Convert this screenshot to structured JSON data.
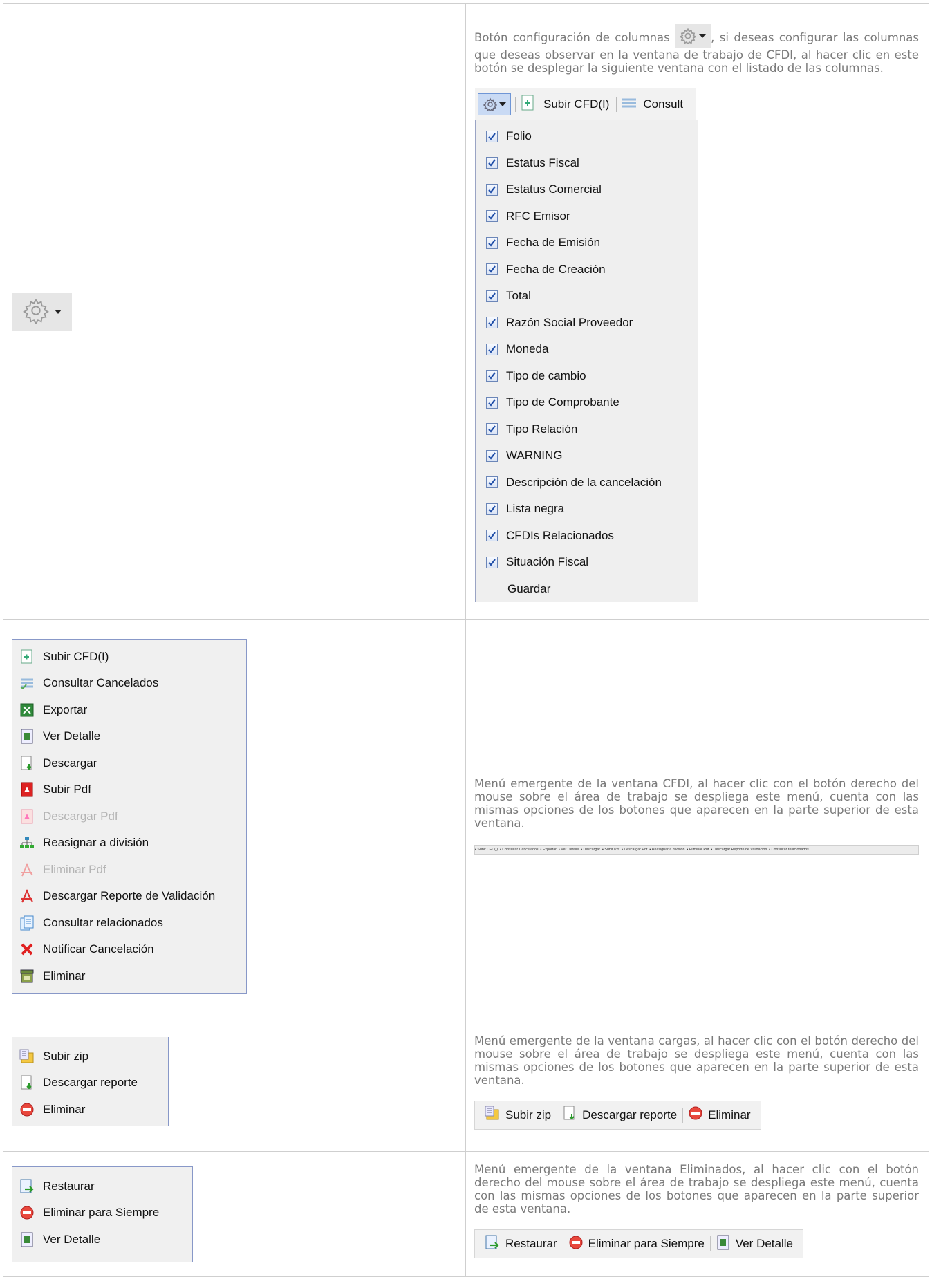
{
  "row1": {
    "description_pre": "Botón configuración de columnas",
    "description_post": ", si deseas configurar las columnas que deseas observar en la ventana de trabajo de CFDI, al hacer clic en este botón se desplegar la siguiente ventana con el listado de las columnas.",
    "toolbar": {
      "upload_label": "Subir CFD(I)",
      "consult_label": "Consult"
    },
    "columns": [
      "Folio",
      "Estatus Fiscal",
      "Estatus Comercial",
      "RFC Emisor",
      "Fecha de Emisión",
      "Fecha de Creación",
      "Total",
      "Razón Social Proveedor",
      "Moneda",
      "Tipo de cambio",
      "Tipo de Comprobante",
      "Tipo Relación",
      "WARNING",
      "Descripción de la cancelación",
      "Lista negra",
      "CFDIs Relacionados",
      "Situación Fiscal"
    ],
    "save_label": "Guardar"
  },
  "row2": {
    "menu": [
      {
        "label": "Subir CFD(I)",
        "icon": "upload-doc-icon",
        "disabled": false
      },
      {
        "label": "Consultar Cancelados",
        "icon": "list-check-icon",
        "disabled": false
      },
      {
        "label": "Exportar",
        "icon": "excel-icon",
        "disabled": false
      },
      {
        "label": "Ver Detalle",
        "icon": "detail-icon",
        "disabled": false
      },
      {
        "label": "Descargar",
        "icon": "download-icon",
        "disabled": false
      },
      {
        "label": "Subir Pdf",
        "icon": "pdf-upload-icon",
        "disabled": false
      },
      {
        "label": "Descargar Pdf",
        "icon": "pdf-download-icon",
        "disabled": true
      },
      {
        "label": "Reasignar a división",
        "icon": "hierarchy-icon",
        "disabled": false
      },
      {
        "label": "Eliminar Pdf",
        "icon": "pdf-delete-icon",
        "disabled": true
      },
      {
        "label": "Descargar Reporte de Validación",
        "icon": "acrobat-icon",
        "disabled": false
      },
      {
        "label": "Consultar relacionados",
        "icon": "related-docs-icon",
        "disabled": false
      },
      {
        "label": "Notificar Cancelación",
        "icon": "red-x-icon",
        "disabled": false
      },
      {
        "label": "Eliminar",
        "icon": "trash-icon",
        "disabled": false
      }
    ],
    "description": "Menú emergente de la ventana CFDI, al hacer clic con el botón derecho del mouse sobre el área de trabajo se despliega este menú, cuenta con las mismas opciones de los botones que aparecen en la parte superior de esta ventana.",
    "tiny_toolbar": [
      "Subir CFD(I)",
      "Consultar Cancelados",
      "Exportar",
      "Ver Detalle",
      "Descargar",
      "Subir Pdf",
      "Descargar Pdf",
      "Reasignar a división",
      "Eliminar Pdf",
      "Descargar Reporte de Validación",
      "Consultar relacionados"
    ]
  },
  "row3": {
    "menu": [
      {
        "label": "Subir zip",
        "icon": "zip-upload-icon"
      },
      {
        "label": "Descargar reporte",
        "icon": "download-icon"
      },
      {
        "label": "Eliminar",
        "icon": "delete-circle-icon"
      }
    ],
    "description": "Menú emergente de la ventana cargas, al hacer clic con el botón derecho del mouse sobre el área de trabajo se despliega este menú, cuenta con las mismas opciones de los botones que aparecen en la parte superior de esta ventana.",
    "toolbar": [
      "Subir zip",
      "Descargar reporte",
      "Eliminar"
    ]
  },
  "row4": {
    "menu": [
      {
        "label": "Restaurar",
        "icon": "restore-icon"
      },
      {
        "label": "Eliminar para Siempre",
        "icon": "delete-circle-icon"
      },
      {
        "label": "Ver Detalle",
        "icon": "detail-icon"
      }
    ],
    "description": "Menú emergente de la ventana Eliminados, al hacer clic con el botón derecho del mouse sobre el área de trabajo se despliega este menú, cuenta con las mismas opciones de los botones que aparecen en la parte superior de esta ventana.",
    "toolbar": [
      "Restaurar",
      "Eliminar para Siempre",
      "Ver Detalle"
    ]
  }
}
